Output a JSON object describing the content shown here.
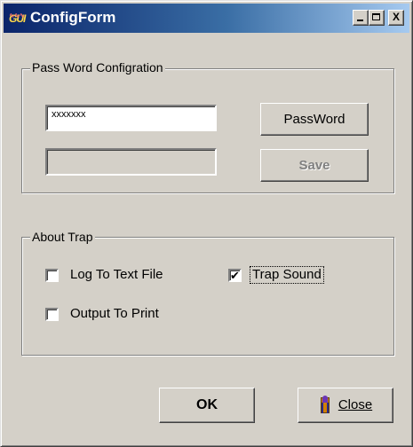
{
  "window": {
    "title": "ConfigForm",
    "app_icon_text": "GUI",
    "minimize_icon": "minimize-icon",
    "maximize_icon": "maximize-icon",
    "close_glyph": "X"
  },
  "password_group": {
    "title": "Pass Word Configration",
    "password_value": "xxxxxxx",
    "second_field_value": "",
    "password_button": "PassWord",
    "save_button": "Save"
  },
  "trap_group": {
    "title": "About Trap",
    "log_to_text_file": {
      "label": "Log To Text File",
      "checked": false
    },
    "output_to_print": {
      "label": "Output To Print",
      "checked": false
    },
    "trap_sound": {
      "label": "Trap  Sound",
      "checked": true
    }
  },
  "footer": {
    "ok_button": "OK",
    "close_button": "Close",
    "close_icon": "door-exit-icon"
  },
  "check_glyph": "✔"
}
